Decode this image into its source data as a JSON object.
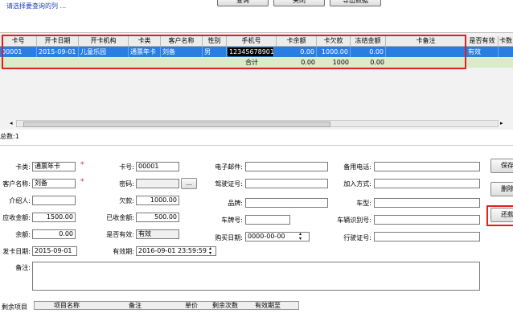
{
  "hint": "请选择要查询的列 ...",
  "toolbar": {
    "btn1": "查询",
    "btn2": "关闭",
    "btn3": "导出数据"
  },
  "grid": {
    "headers": [
      "卡号",
      "开卡日期",
      "开卡机构",
      "卡类",
      "客户名称",
      "性别",
      "手机号",
      "卡余额",
      "卡欠款",
      "冻结金额",
      "卡备注",
      "是否有效",
      "卡数"
    ],
    "row": {
      "card_no": "00001",
      "open_date": "2015-09-01",
      "org": "儿童乐园",
      "card_type": "通票年卡",
      "customer": "刘备",
      "gender": "男",
      "phone": "12345678901",
      "balance": "0.00",
      "debt": "1000.00",
      "frozen": "0.00",
      "remark": "",
      "valid": "有效"
    },
    "summary": {
      "label": "合计",
      "balance": "0.00",
      "debt": "1000",
      "frozen": "0.00"
    }
  },
  "total": "总数:1",
  "form": {
    "card_type_label": "卡类:",
    "card_type": "通票年卡",
    "card_no_label": "卡号:",
    "card_no": "00001",
    "email_label": "电子邮件:",
    "email": "",
    "backup_phone_label": "备用电话:",
    "backup_phone": "",
    "customer_label": "客户名称:",
    "customer": "刘备",
    "password_label": "密码:",
    "password": "",
    "password_btn": "...",
    "license_label": "驾驶证号:",
    "license": "",
    "join_label": "加入方式:",
    "join": "",
    "intro_label": "介绍人:",
    "intro": "",
    "debt_label": "欠款:",
    "debt": "1000.00",
    "brand_label": "品牌:",
    "brand": "",
    "car_type_label": "车型:",
    "car_type": "",
    "receivable_label": "应收金额:",
    "receivable": "1500.00",
    "received_label": "已收金额:",
    "received": "500.00",
    "plate_label": "车牌号:",
    "plate": "",
    "vin_label": "车辆识别号:",
    "vin": "",
    "balance_label": "余额:",
    "balance": "0.00",
    "valid_label": "是否有效:",
    "valid": "有效",
    "buy_date_label": "购买日期:",
    "buy_date": "0000-00-00",
    "drive_lic_label": "行驶证号:",
    "drive_lic": "",
    "issue_date_label": "发卡日期:",
    "issue_date": "2015-09-01",
    "expire_label": "有效期:",
    "expire": "2016-09-01 23:59:59",
    "remark_label": "备注:"
  },
  "side_buttons": {
    "save": "保存",
    "delete": "删除",
    "repay": "还款"
  },
  "subgrid": {
    "label": "剩余项目",
    "headers": [
      "项目名称",
      "备注",
      "单价",
      "剩余次数",
      "有效期至"
    ]
  },
  "colors": {
    "selection": "#2a7de1",
    "summary_row": "#d9ecc8",
    "highlight": "#e02020",
    "hint": "#1f3fbf"
  }
}
